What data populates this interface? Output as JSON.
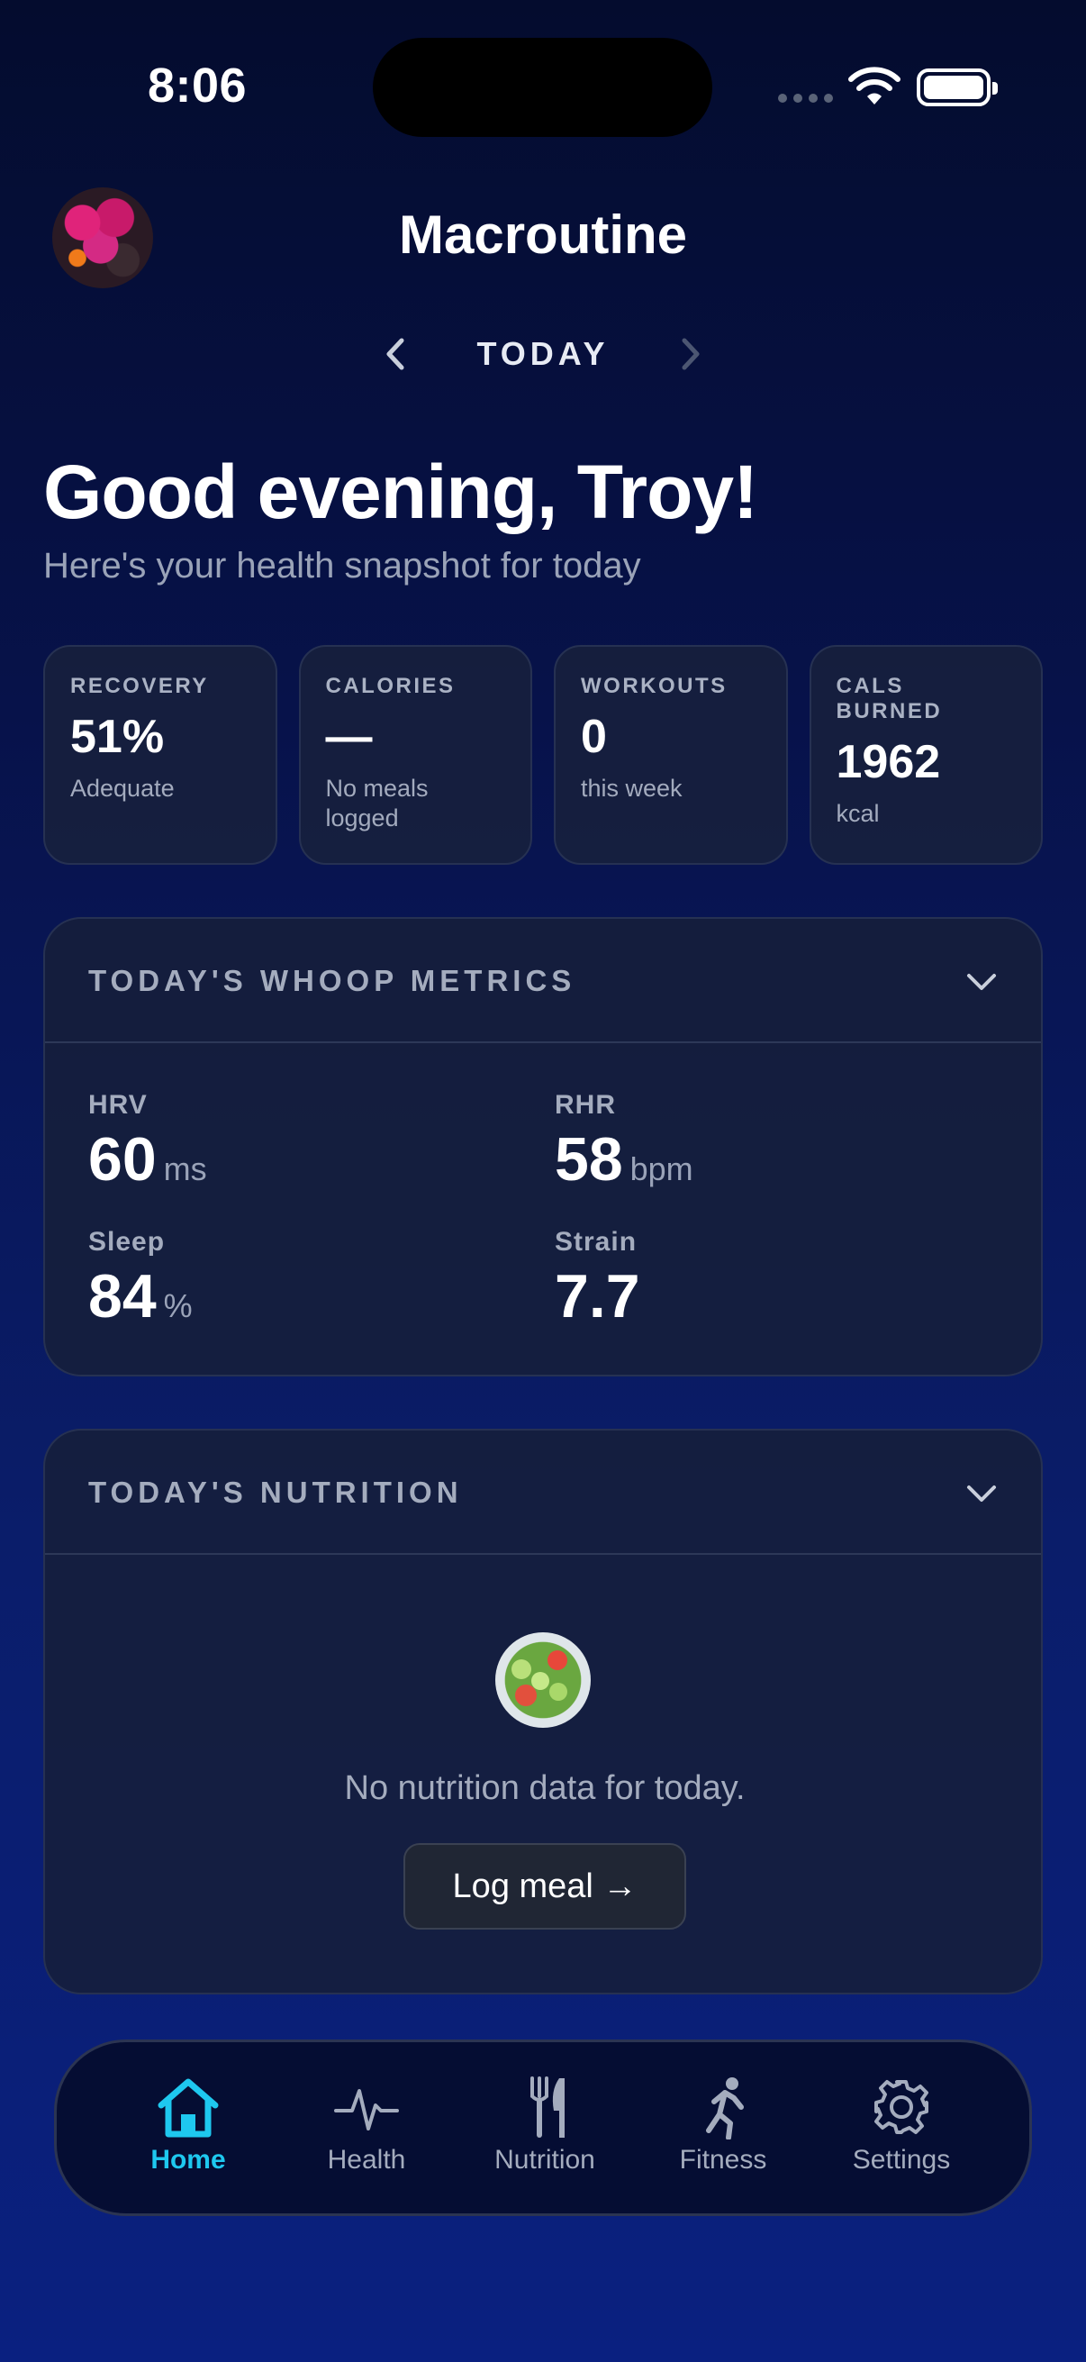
{
  "status_bar": {
    "time": "8:06"
  },
  "header": {
    "app_title": "Macroutine",
    "date_label": "TODAY"
  },
  "greeting": {
    "title": "Good evening, Troy!",
    "subtitle": "Here's your health snapshot for today"
  },
  "stats": [
    {
      "label": "RECOVERY",
      "value": "51%",
      "sub": "Adequate"
    },
    {
      "label": "CALORIES",
      "value": "—",
      "sub": "No meals logged"
    },
    {
      "label": "WORKOUTS",
      "value": "0",
      "sub": "this week"
    },
    {
      "label": "CALS BURNED",
      "value": "1962",
      "sub": "kcal"
    }
  ],
  "whoop": {
    "title": "TODAY'S WHOOP METRICS",
    "metrics": [
      {
        "label": "HRV",
        "value": "60",
        "unit": "ms"
      },
      {
        "label": "RHR",
        "value": "58",
        "unit": "bpm"
      },
      {
        "label": "Sleep",
        "value": "84",
        "unit": "%"
      },
      {
        "label": "Strain",
        "value": "7.7",
        "unit": ""
      }
    ]
  },
  "nutrition": {
    "title": "TODAY'S NUTRITION",
    "empty_text": "No nutrition data for today.",
    "log_button": "Log meal →"
  },
  "tabbar": {
    "tabs": [
      {
        "label": "Home",
        "icon": "home-icon",
        "active": true
      },
      {
        "label": "Health",
        "icon": "heartbeat-icon"
      },
      {
        "label": "Nutrition",
        "icon": "fork-knife-icon"
      },
      {
        "label": "Fitness",
        "icon": "runner-icon"
      },
      {
        "label": "Settings",
        "icon": "gear-icon"
      }
    ],
    "accent_color": "#1ec8ef"
  }
}
